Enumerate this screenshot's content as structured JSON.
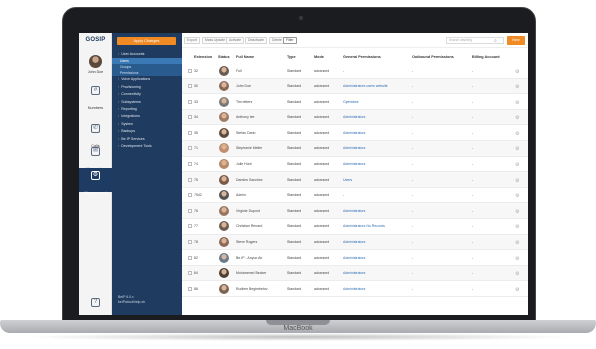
{
  "device": {
    "label": "MacBook"
  },
  "rail": {
    "logo": "GOSIP",
    "user_name": "John Doe",
    "items": [
      {
        "label": "Numbers",
        "icon": "numbers-icon",
        "glyph": "#"
      },
      {
        "label": "Calls",
        "icon": "phone-icon",
        "glyph": "✆"
      },
      {
        "label": "Messaging",
        "icon": "chat-icon",
        "glyph": "✉"
      },
      {
        "label": "Management",
        "icon": "management-icon",
        "glyph": "⚙"
      },
      {
        "label": "Help",
        "icon": "help-icon",
        "glyph": "?"
      }
    ]
  },
  "nav": {
    "apply_label": "Apply Changes",
    "items": [
      {
        "label": "User Accounts"
      },
      {
        "label": "Users",
        "sub": true,
        "selected": true
      },
      {
        "label": "Groups",
        "sub": true
      },
      {
        "label": "Permissions",
        "sub": true
      },
      {
        "label": "Voice Applications"
      },
      {
        "label": "Provisioning"
      },
      {
        "label": "Connectivity"
      },
      {
        "label": "Subsystems"
      },
      {
        "label": "Reporting"
      },
      {
        "label": "Integrations"
      },
      {
        "label": "System"
      },
      {
        "label": "Backups"
      },
      {
        "label": "Be IP Services"
      },
      {
        "label": "Development Tools"
      }
    ],
    "footer_line1": "BeIP 6.0.x",
    "footer_line2": "beIPcloud/help.sh"
  },
  "toolbar": {
    "buttons": [
      "Export",
      "Mass Update",
      "Activate",
      "Deactivate",
      "Delete",
      "Filter"
    ],
    "search_placeholder": "Search anything",
    "new_label": "New"
  },
  "table": {
    "columns": [
      "Extension",
      "Status",
      "Full Name",
      "Type",
      "Mode",
      "General Permissions",
      "Outbound Permissions",
      "Billing Account"
    ],
    "rows": [
      {
        "ext": "32",
        "name": "Full",
        "type": "Standard",
        "mode": "advanced",
        "general": "-",
        "outbound": "-",
        "billing": "-",
        "face": "#6a5a50"
      },
      {
        "ext": "30",
        "name": "John Doe",
        "type": "Standard",
        "mode": "advanced",
        "general": "Administrators users website",
        "outbound": "-",
        "billing": "-",
        "face": "#8a6a55"
      },
      {
        "ext": "33",
        "name": "Tim letters",
        "type": "Standard",
        "mode": "advanced",
        "general": "Operators",
        "outbound": "-",
        "billing": "-",
        "face": "#7a7a7a"
      },
      {
        "ext": "34",
        "name": "Anthony lee",
        "type": "Standard",
        "mode": "advanced",
        "general": "Administrators",
        "outbound": "-",
        "billing": "-",
        "face": "#a07a62"
      },
      {
        "ext": "35",
        "name": "Stefan Dario",
        "type": "Standard",
        "mode": "advanced",
        "general": "Administrators",
        "outbound": "-",
        "billing": "-",
        "face": "#5e4b40"
      },
      {
        "ext": "71",
        "name": "Stephanie Meller",
        "type": "Standard",
        "mode": "advanced",
        "general": "Administrators",
        "outbound": "-",
        "billing": "-",
        "face": "#c08e6e"
      },
      {
        "ext": "74",
        "name": "Julie Hunt",
        "type": "Standard",
        "mode": "advanced",
        "general": "Administrators",
        "outbound": "-",
        "billing": "-",
        "face": "#b88766"
      },
      {
        "ext": "75",
        "name": "Damien Sanchez",
        "type": "Standard",
        "mode": "advanced",
        "general": "Users",
        "outbound": "-",
        "billing": "-",
        "face": "#7b5a48"
      },
      {
        "ext": "7542",
        "name": "Admin",
        "type": "Standard",
        "mode": "advanced",
        "general": "-",
        "outbound": "-",
        "billing": "-",
        "face": "#555555"
      },
      {
        "ext": "76",
        "name": "Virginie Dupont",
        "type": "Standard",
        "mode": "advanced",
        "general": "Administrators",
        "outbound": "-",
        "billing": "-",
        "face": "#9a7461"
      },
      {
        "ext": "77",
        "name": "Christian Renard",
        "type": "Standard",
        "mode": "advanced",
        "general": "Administrators No Records",
        "outbound": "-",
        "billing": "-",
        "face": "#6e5d52"
      },
      {
        "ext": "78",
        "name": "Steve Rogers",
        "type": "Standard",
        "mode": "advanced",
        "general": "Administrators",
        "outbound": "-",
        "billing": "-",
        "face": "#8c6b57"
      },
      {
        "ext": "82",
        "name": "Be IP - Anyoo Air",
        "type": "Standard",
        "mode": "advanced",
        "general": "Administrators",
        "outbound": "-",
        "billing": "-",
        "face": "#6a7c8c"
      },
      {
        "ext": "84",
        "name": "Muhammed Becker",
        "type": "Standard",
        "mode": "advanced",
        "general": "Administrators",
        "outbound": "-",
        "billing": "-",
        "face": "#4e3f36"
      },
      {
        "ext": "86",
        "name": "Rudiem Begimbetov",
        "type": "Standard",
        "mode": "advanced",
        "general": "Administrators",
        "outbound": "-",
        "billing": "-",
        "face": "#7d6250"
      }
    ]
  }
}
